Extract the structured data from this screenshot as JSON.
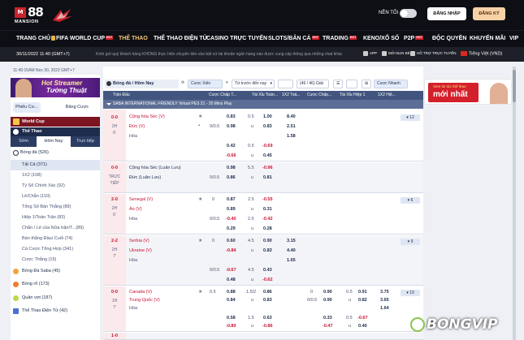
{
  "header": {
    "logo_number": "88",
    "logo_box": "M",
    "logo_sub": "MANSION",
    "dark_mode_label": "NỀN TỐI",
    "login_label": "ĐĂNG NHẬP",
    "register_label": "ĐĂNG KÝ"
  },
  "nav": {
    "items": [
      {
        "label": "TRANG CHỦ"
      },
      {
        "label": "FIFA WORLD CUP",
        "badge": "HOT"
      },
      {
        "label": "THỂ THAO"
      },
      {
        "label": "THỂ THAO ĐIỆN TỬ"
      },
      {
        "label": "CASINO TRỰC TUYẾN"
      },
      {
        "label": "SLOTS/BẮN CÁ",
        "badge": "HOT"
      },
      {
        "label": "TRADING",
        "badge": "HOT"
      },
      {
        "label": "KENO/XỔ SỐ"
      },
      {
        "label": "P2P",
        "badge": "HOT"
      },
      {
        "label": "ĐỘC QUYỀN"
      },
      {
        "label": "KHUYẾN MÃI"
      },
      {
        "label": "VIP"
      }
    ],
    "active_index": 2
  },
  "infobar": {
    "datetime": "30/11/2022 11:40 (GMT+7)",
    "marquee": "Kính gửi quý khách hàng KHÔNG thực hiện chuyển tiền vào bất cứ tài khoản ngân hàng nào được cung cấp thông qua những chat khác",
    "links": [
      "APP",
      "MỞI BẠN BÈ",
      "HỖ TRỢ TRỰC TUYẾN"
    ],
    "language": "Tiếng Việt (VND)"
  },
  "sidebar": {
    "time": "11:40:15AM Nov 30, 2022 GMT+7",
    "banner_line1": "Hot Streamer",
    "banner_line2": "Tường Thuật",
    "tabs": [
      "Phiếu Cư...",
      "Bảng Cược"
    ],
    "world_cup": "World Cup",
    "the_thao": "Thể Thao",
    "time_tabs": [
      "Sớm",
      "Hôm Nay",
      "Trực tiếp"
    ],
    "category": "Bóng đá (526)",
    "sub_items": [
      "Tất Cả (371)",
      "1X2 (108)",
      "Tỷ Số Chính Xác (92)",
      "Lẻ/Chẵn (110)",
      "Tổng Số Bàn Thắng (89)",
      "Hiệp 1/Toàn Trận (83)",
      "Chẵn / Lẻ của Nửa trận/T...(89)",
      "Bàn thắng Đầu/ Cuối (74)",
      "Cá Cược Tổng Hợp (341)",
      "Cược Thắng (15)"
    ],
    "sports": [
      {
        "label": "Bóng Đá Saba (45)",
        "color": "#f2a33a"
      },
      {
        "label": "Bóng rổ (173)",
        "color": "#f37b2b"
      },
      {
        "label": "Quần vợt (187)",
        "color": "#b9d94a"
      },
      {
        "label": "Thể Thao Điện Tử (42)",
        "color": "#4b6fd6"
      }
    ]
  },
  "main": {
    "title": "Bóng đá / Hôm Nay",
    "controls": [
      "Cược Xiên",
      "Từ trước đến nay",
      "(46 / 46) Giải",
      "Cược Nhanh"
    ],
    "headers": [
      "Trận Đấu",
      "Cược Chấp T...",
      "Tài Xỉu Toàn...",
      "1X2 Toà...",
      "Cược Chấp...",
      "Tài Xỉu Hiệp 1",
      "1X2 Hiệ..."
    ],
    "league": "SABA INTERNATIONAL FRIENDLY Virtual PES 21 - 20 Mins Play",
    "matches": [
      {
        "score": "0-0",
        "period": "2H",
        "minute": "6'",
        "home": "Cộng hòa Séc (V)",
        "away": "Đức (V)",
        "draw": "Hòa",
        "home_fav": true,
        "away_fav": true,
        "hcap": [
          "",
          "0/0.5",
          "",
          ""
        ],
        "hcap_odds": [
          "0.83",
          "0.98",
          "0.42",
          "-0.66"
        ],
        "ou": [
          "0.5",
          "u",
          "0.5",
          "u"
        ],
        "ou_odds": [
          "1.00",
          "0.83",
          "-0.69",
          "0.45"
        ],
        "x12": [
          "8.40",
          "2.51",
          "1.58",
          ""
        ],
        "more": "12"
      },
      {
        "score": "0-0",
        "period": "TRỰC",
        "minute": "TIẾP",
        "home": "Cộng hòa Séc (Luân Lưu)",
        "away": "Đức (Luân Lưu)",
        "draw": "",
        "home_fav": false,
        "away_fav": false,
        "hcap": [
          "",
          "0/0.5",
          "",
          ""
        ],
        "hcap_odds": [
          "0.98",
          "0.86",
          "",
          ""
        ],
        "ou": [
          "5.5",
          "u",
          "",
          ""
        ],
        "ou_odds": [
          "-0.96",
          "0.81",
          "",
          ""
        ],
        "x12": [
          "",
          "",
          "",
          ""
        ],
        "more": ""
      },
      {
        "score": "2-0",
        "period": "2H",
        "minute": "6'",
        "home": "Senegal (V)",
        "away": "Áo (V)",
        "draw": "Hòa",
        "home_fav": true,
        "away_fav": true,
        "hcap": [
          "0",
          "",
          "0/0.5",
          ""
        ],
        "hcap_odds": [
          "0.87",
          "0.89",
          "-0.40",
          "0.29"
        ],
        "ou": [
          "2.5",
          "u",
          "2.5",
          "u"
        ],
        "ou_odds": [
          "-0.55",
          "0.31",
          "-0.42",
          "0.28"
        ],
        "x12": [
          "",
          "",
          "",
          ""
        ],
        "more": "6"
      },
      {
        "score": "2-2",
        "period": "2H",
        "minute": "7'",
        "home": "Serbia (V)",
        "away": "Ukraine (V)",
        "draw": "Hòa",
        "home_fav": true,
        "away_fav": true,
        "hcap": [
          "0",
          "",
          "0/0.5",
          ""
        ],
        "hcap_odds": [
          "0.60",
          "-0.84",
          "-0.67",
          "0.48"
        ],
        "ou": [
          "4.5",
          "u",
          "4.5",
          "u"
        ],
        "ou_odds": [
          "0.90",
          "0.83",
          "0.43",
          "-0.62"
        ],
        "x12": [
          "3.15",
          "4.40",
          "1.65",
          ""
        ],
        "more": "9"
      },
      {
        "score": "0-0",
        "period": "1H",
        "minute": "7'",
        "home": "Canada (V)",
        "away": "Trung Quốc (V)",
        "draw": "Hòa",
        "home_fav": true,
        "away_fav": true,
        "hcap": [
          "0.5",
          "",
          "",
          ""
        ],
        "hcap_odds": [
          "0.88",
          "0.84",
          "0.58",
          "-0.80"
        ],
        "ou": [
          "1.5/2",
          "u",
          "1.5",
          "u"
        ],
        "ou_odds": [
          "0.86",
          "0.83",
          "0.63",
          "-0.86"
        ],
        "x12": [
          "",
          "",
          "",
          ""
        ],
        "h1_hcap": [
          "0",
          "0/0.5",
          "0.33",
          "-0.47"
        ],
        "h1_hcap_odds": [
          "0.90",
          "0.90",
          "0.90",
          "0.30"
        ],
        "h1_ou": [
          "0.5",
          "u",
          "0.5",
          "u"
        ],
        "h1_ou_odds": [
          "0.91",
          "0.82",
          "-0.67",
          "0.40"
        ],
        "h1_x12": [
          "3.75",
          "3.65",
          "1.64",
          ""
        ],
        "more": "19"
      }
    ],
    "next_score": "1-0"
  },
  "right_banner": {
    "line1": "Xem tin tức thể thao",
    "line2": "mới nhất"
  },
  "watermark": "BONGVIP"
}
